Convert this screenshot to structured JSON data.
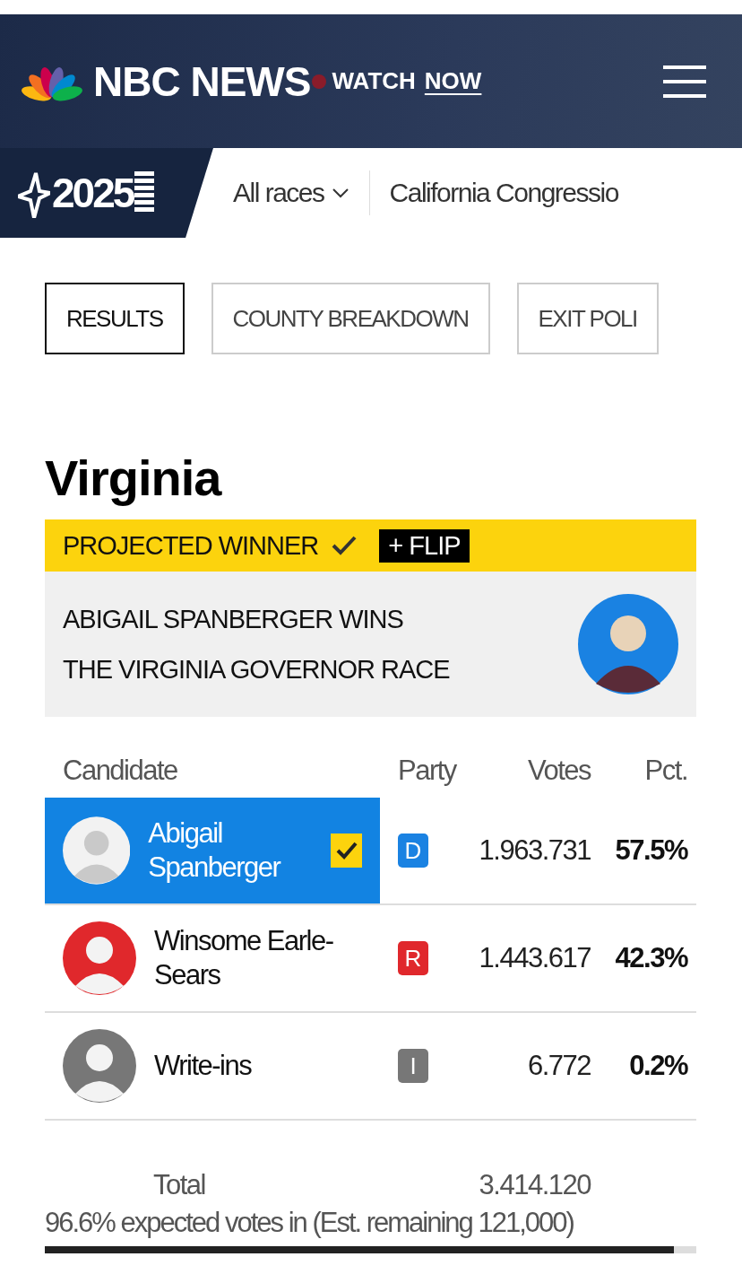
{
  "header": {
    "brand": "NBC NEWS",
    "watch_label": "WATCH",
    "watch_link": "NOW"
  },
  "nav": {
    "year": "2025",
    "items": [
      {
        "label": "All races",
        "dropdown": true
      },
      {
        "label": "California Congressio",
        "dropdown": false
      }
    ]
  },
  "tabs": [
    {
      "label": "RESULTS",
      "selected": true
    },
    {
      "label": "COUNTY BREAKDOWN",
      "selected": false
    },
    {
      "label": "EXIT POLI",
      "selected": false
    }
  ],
  "race": {
    "title": "Virginia",
    "banner": {
      "label": "PROJECTED WINNER",
      "flip": "+ FLIP"
    },
    "headline": "ABIGAIL SPANBERGER WINS THE VIRGINIA GOVERNOR RACE",
    "columns": [
      "Candidate",
      "Party",
      "Votes",
      "Pct."
    ],
    "rows": [
      {
        "name": "Abigail Spanberger",
        "party": "D",
        "color": "#1a82e2",
        "votes": "1.963.731",
        "pct": "57.5%",
        "selected": true,
        "winner": true
      },
      {
        "name": "Winsome Earle-Sears",
        "party": "R",
        "color": "#e0282c",
        "votes": "1.443.617",
        "pct": "42.3%",
        "selected": false,
        "winner": false
      },
      {
        "name": "Write-ins",
        "party": "I",
        "color": "#777777",
        "votes": "6.772",
        "pct": "0.2%",
        "selected": false,
        "winner": false
      }
    ],
    "total_label": "Total",
    "total_votes": "3.414.120",
    "expected": "96.6% expected votes in (Est. remaining 121,000)",
    "level": 0.966
  }
}
